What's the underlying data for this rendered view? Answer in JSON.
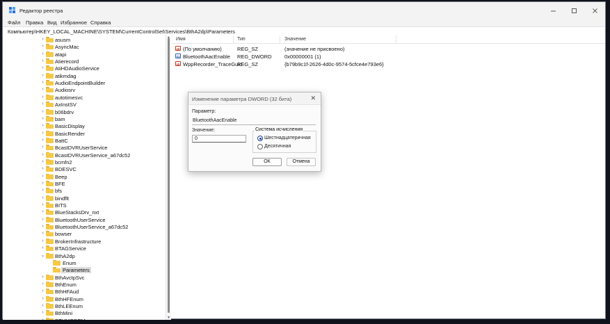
{
  "window": {
    "title": "Редактор реестра"
  },
  "menu": [
    "Файл",
    "Правка",
    "Вид",
    "Избранное",
    "Справка"
  ],
  "address": "Компьютер\\HKEY_LOCAL_MACHINE\\SYSTEM\\CurrentControlSet\\Services\\BthA2dp\\Parameters",
  "tree": [
    {
      "label": "asusm"
    },
    {
      "label": "AsyncMac"
    },
    {
      "label": "atapi"
    },
    {
      "label": "Atierecord"
    },
    {
      "label": "AtiHDAudioService"
    },
    {
      "label": "atikmdag"
    },
    {
      "label": "AudioEndpointBuilder"
    },
    {
      "label": "Audiosrv"
    },
    {
      "label": "autotimesvc"
    },
    {
      "label": "AxInstSV"
    },
    {
      "label": "b06bdrv"
    },
    {
      "label": "bam"
    },
    {
      "label": "BasicDisplay"
    },
    {
      "label": "BasicRender"
    },
    {
      "label": "BattC"
    },
    {
      "label": "BcastDVRUserService"
    },
    {
      "label": "BcastDVRUserService_a67dc52"
    },
    {
      "label": "bcmfn2"
    },
    {
      "label": "BDESVC"
    },
    {
      "label": "Beep"
    },
    {
      "label": "BFE"
    },
    {
      "label": "bfs"
    },
    {
      "label": "bindflt"
    },
    {
      "label": "BITS"
    },
    {
      "label": "BlueStacksDrv_nxt"
    },
    {
      "label": "BluetoothUserService"
    },
    {
      "label": "BluetoothUserService_a67dc52"
    },
    {
      "label": "bowser"
    },
    {
      "label": "BrokerInfrastructure"
    },
    {
      "label": "BTAGService"
    },
    {
      "label": "BthA2dp",
      "expanded": true
    },
    {
      "label": "Enum",
      "level": 2
    },
    {
      "label": "Parameters",
      "level": 2,
      "selected": true
    },
    {
      "label": "BthAvctpSvc"
    },
    {
      "label": "BthEnum"
    },
    {
      "label": "BthHFAud"
    },
    {
      "label": "BthHFEnum"
    },
    {
      "label": "BthLEEnum"
    },
    {
      "label": "BthMini"
    },
    {
      "label": "BTHMODEM"
    }
  ],
  "columns": {
    "name": "Имя",
    "type": "Тип",
    "value": "Значение"
  },
  "values": [
    {
      "name": "(По умолчанию)",
      "type": "REG_SZ",
      "data": "(значение не присвоено)",
      "icon": "ab"
    },
    {
      "name": "BluetoothAacEnable",
      "type": "REG_DWORD",
      "data": "0x00000001 (1)",
      "icon": "dw"
    },
    {
      "name": "WppRecorder_TraceGuid",
      "type": "REG_SZ",
      "data": "{b79b9c1f-2626-4d0c-9574-5cfce4e793e6}",
      "icon": "ab"
    }
  ],
  "dialog": {
    "title": "Изменение параметра DWORD (32 бита)",
    "param_label": "Параметр:",
    "param_value": "BluetoothAacEnable",
    "value_label": "Значение:",
    "value": "0",
    "base_label": "Система исчисления",
    "hex_label": "Шестнадцатеричная",
    "dec_label": "Десятичная",
    "hex_selected": true,
    "ok": "ОК",
    "cancel": "Отмена"
  }
}
